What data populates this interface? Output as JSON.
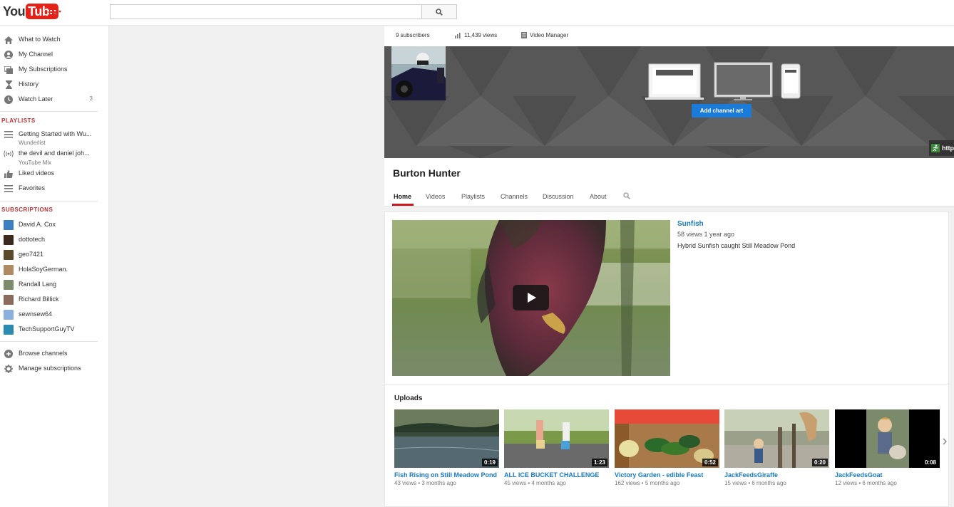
{
  "header": {
    "logo_you": "You",
    "logo_tube": "Tube",
    "search_value": "",
    "brand_color": "#e62117"
  },
  "sidebar": {
    "main_items": [
      {
        "label": "What to Watch",
        "icon": "home-icon"
      },
      {
        "label": "My Channel",
        "icon": "person-icon"
      },
      {
        "label": "My Subscriptions",
        "icon": "subscriptions-icon"
      },
      {
        "label": "History",
        "icon": "hourglass-icon"
      },
      {
        "label": "Watch Later",
        "icon": "clock-icon",
        "count": "3"
      }
    ],
    "playlists_heading": "PLAYLISTS",
    "playlists": [
      {
        "label": "Getting Started with Wu...",
        "sub": "Wunderlist",
        "icon": "list-icon"
      },
      {
        "label": "the devil and daniel joh...",
        "sub": "YouTube Mix",
        "icon": "mix-icon"
      },
      {
        "label": "Liked videos",
        "icon": "thumbs-up-icon"
      },
      {
        "label": "Favorites",
        "icon": "list-icon"
      }
    ],
    "subscriptions_heading": "SUBSCRIPTIONS",
    "subscriptions": [
      {
        "label": "David A. Cox",
        "color": "#3b7fc2"
      },
      {
        "label": "dottotech",
        "color": "#3a2a1e"
      },
      {
        "label": "geo7421",
        "color": "#5a4a2a"
      },
      {
        "label": "HolaSoyGerman.",
        "color": "#b08a60"
      },
      {
        "label": "Randall Lang",
        "color": "#7a8a6a"
      },
      {
        "label": "Richard Billick",
        "color": "#8a6a5a"
      },
      {
        "label": "sewnsew64",
        "color": "#8ab0e0"
      },
      {
        "label": "TechSupportGuyTV",
        "color": "#2a8ab0"
      }
    ],
    "footer_items": [
      {
        "label": "Browse channels",
        "icon": "plus-circle-icon"
      },
      {
        "label": "Manage subscriptions",
        "icon": "gear-icon"
      }
    ]
  },
  "channel": {
    "subscribers": "9 subscribers",
    "views": "11,439 views",
    "video_manager": "Video Manager",
    "add_art": "Add channel art",
    "link_text": "http",
    "title": "Burton Hunter",
    "tabs": [
      "Home",
      "Videos",
      "Playlists",
      "Channels",
      "Discussion",
      "About"
    ],
    "accent": "#1b7bd9"
  },
  "featured": {
    "title": "Sunfish",
    "meta": "58 views  1 year ago",
    "description": "Hybrid Sunfish caught Still Meadow Pond"
  },
  "uploads": {
    "heading": "Uploads",
    "items": [
      {
        "title": "Fish Rising on Still Meadow Pond",
        "duration": "0:19",
        "views": "43 views",
        "age": "3 months ago"
      },
      {
        "title": "ALL ICE BUCKET CHALLENGE",
        "duration": "1:23",
        "views": "45 views",
        "age": "4 months ago"
      },
      {
        "title": "Victory Garden - edible Feast",
        "duration": "0:52",
        "views": "162 views",
        "age": "5 months ago"
      },
      {
        "title": "JackFeedsGiraffe",
        "duration": "0:20",
        "views": "15 views",
        "age": "6 months ago"
      },
      {
        "title": "JackFeedsGoat",
        "duration": "0:08",
        "views": "12 views",
        "age": "6 months ago"
      }
    ]
  }
}
